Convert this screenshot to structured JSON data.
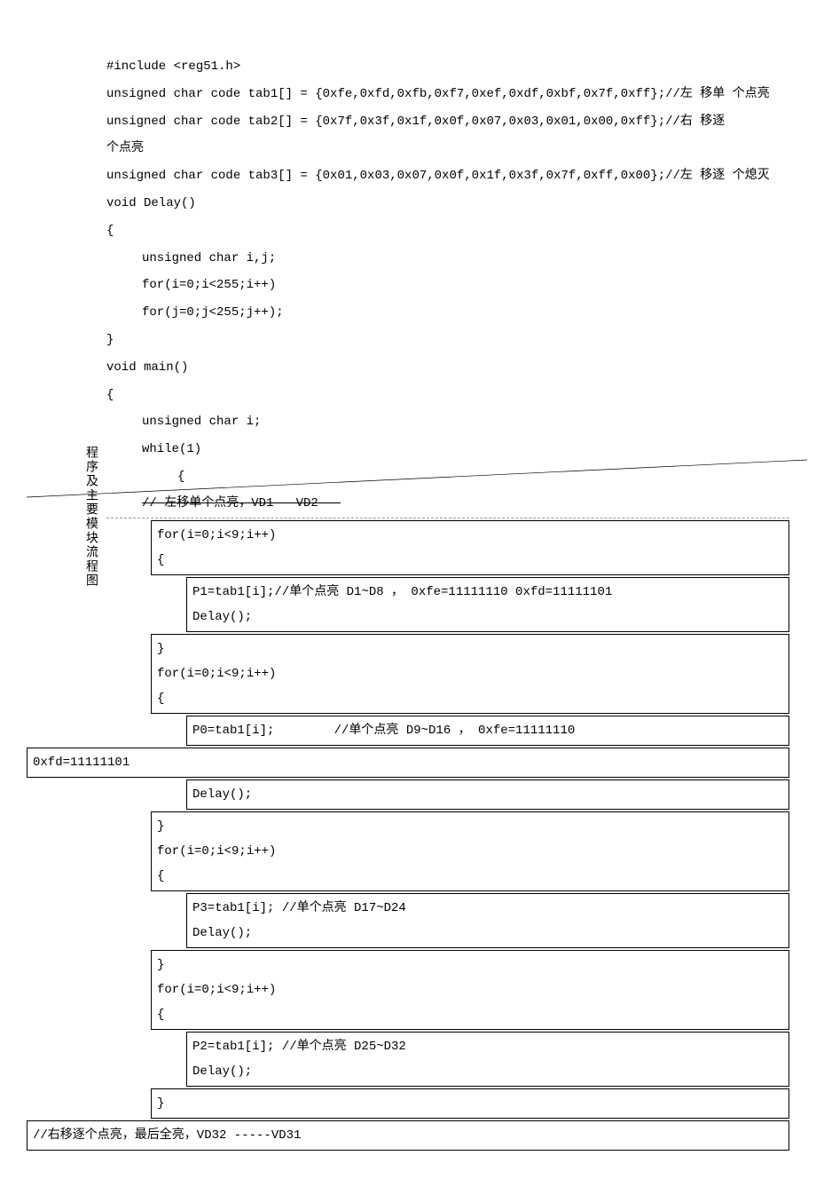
{
  "vertical_label": "程序及主要模块流程图",
  "lines": {
    "l1": "#include <reg51.h>",
    "l2": "unsigned char code tab1[] = {0xfe,0xfd,0xfb,0xf7,0xef,0xdf,0xbf,0x7f,0xff};//左 移单 个点亮",
    "l3": "unsigned char code tab2[] = {0x7f,0x3f,0x1f,0x0f,0x07,0x03,0x01,0x00,0xff};//右 移逐",
    "l4": "个点亮",
    "l5": "unsigned char code tab3[] = {0x01,0x03,0x07,0x0f,0x1f,0x3f,0x7f,0xff,0x00};//左 移逐 个熄灭",
    "l6": "void Delay()",
    "l7": "{",
    "l8": "unsigned char i,j;",
    "l9": "for(i=0;i<255;i++)",
    "l10": "for(j=0;j<255;j++);",
    "l11": "}",
    "l12": "void main()",
    "l13": "{",
    "l14": "unsigned char i;",
    "l15": "while(1)",
    "l16": "{",
    "l17": "// 左移单个点亮，VD1---VD2---"
  },
  "boxes": {
    "b1": "for(i=0;i<9;i++)\n{",
    "b2": "P1=tab1[i];//单个点亮 D1~D8 ， 0xfe=11111110    0xfd=11111101\nDelay();",
    "b3": "}\nfor(i=0;i<9;i++)\n{",
    "b4": "P0=tab1[i];        //单个点亮 D9~D16 ， 0xfe=11111110",
    "b5": "0xfd=11111101",
    "b6": "Delay();",
    "b7": "}\nfor(i=0;i<9;i++)\n{",
    "b8": "P3=tab1[i];        //单个点亮 D17~D24\nDelay();",
    "b9": "}\nfor(i=0;i<9;i++)\n{",
    "b10": "P2=tab1[i];        //单个点亮 D25~D32\nDelay();",
    "b11": "}",
    "b12": "//右移逐个点亮，最后全亮，VD32 -----VD31"
  }
}
